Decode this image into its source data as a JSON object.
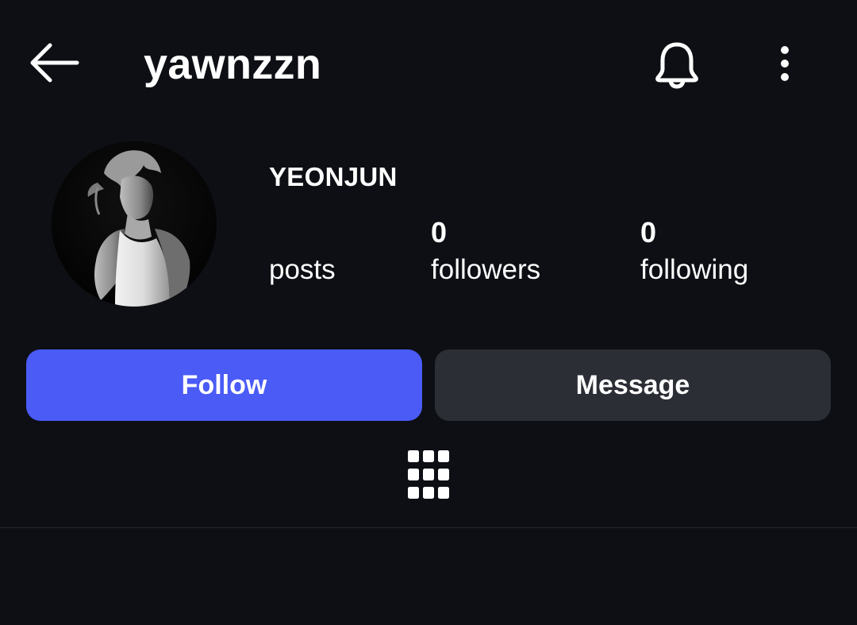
{
  "header": {
    "back_icon": "arrow-left-icon",
    "username": "yawnzzn",
    "notification_icon": "bell-icon",
    "more_icon": "more-vertical-icon"
  },
  "profile": {
    "avatar_description": "black-and-white portrait photo",
    "display_name": "YEONJUN",
    "stats": {
      "posts": {
        "count": "",
        "label": "posts"
      },
      "followers": {
        "count": "0",
        "label": "followers"
      },
      "following": {
        "count": "0",
        "label": "following"
      }
    }
  },
  "actions": {
    "follow_label": "Follow",
    "message_label": "Message"
  },
  "tabs": {
    "grid_icon": "grid-icon"
  },
  "colors": {
    "background": "#0d0f14",
    "follow_button": "#4a5bf6",
    "message_button": "#2b2e35",
    "text": "#ffffff"
  }
}
